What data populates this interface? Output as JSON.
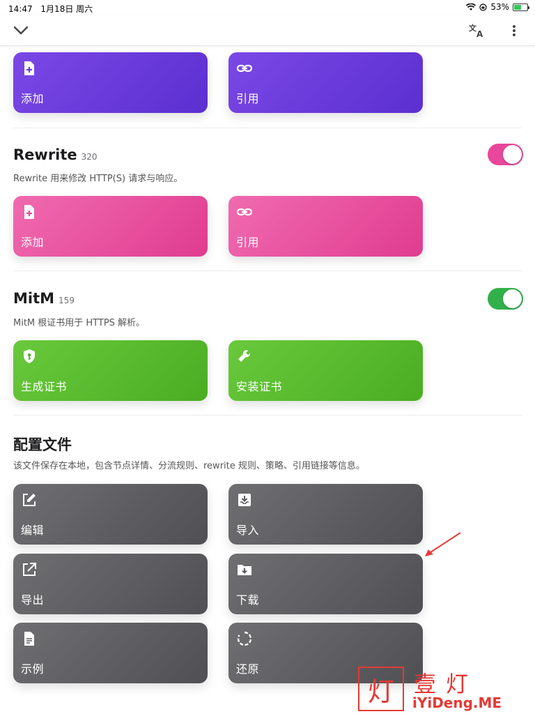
{
  "status_bar": {
    "time": "14:47",
    "date": "1月18日 周六",
    "battery": "53%",
    "battery_level": 0.53
  },
  "nav": {
    "back_icon": "chevron-down-icon",
    "translate_icon": "translate-icon",
    "more_icon": "more-vertical-icon"
  },
  "top_cards": {
    "add_label": "添加",
    "ref_label": "引用"
  },
  "rewrite": {
    "title": "Rewrite",
    "count": "320",
    "desc": "Rewrite 用来修改 HTTP(S) 请求与响应。",
    "enabled": true,
    "color": "#e8489b",
    "add_label": "添加",
    "ref_label": "引用"
  },
  "mitm": {
    "title": "MitM",
    "count": "159",
    "desc": "MitM 根证书用于 HTTPS 解析。",
    "enabled": true,
    "color": "#32b14a",
    "generate_label": "生成证书",
    "install_label": "安装证书"
  },
  "profile": {
    "title": "配置文件",
    "desc": "该文件保存在本地，包含节点详情、分流规则、rewrite 规则、策略、引用链接等信息。",
    "edit_label": "编辑",
    "import_label": "导入",
    "export_label": "导出",
    "download_label": "下载",
    "example_label": "示例",
    "restore_label": "还原"
  },
  "watermark": {
    "char": "灯",
    "title": "壹灯",
    "sub": "iYiDeng.ME"
  }
}
